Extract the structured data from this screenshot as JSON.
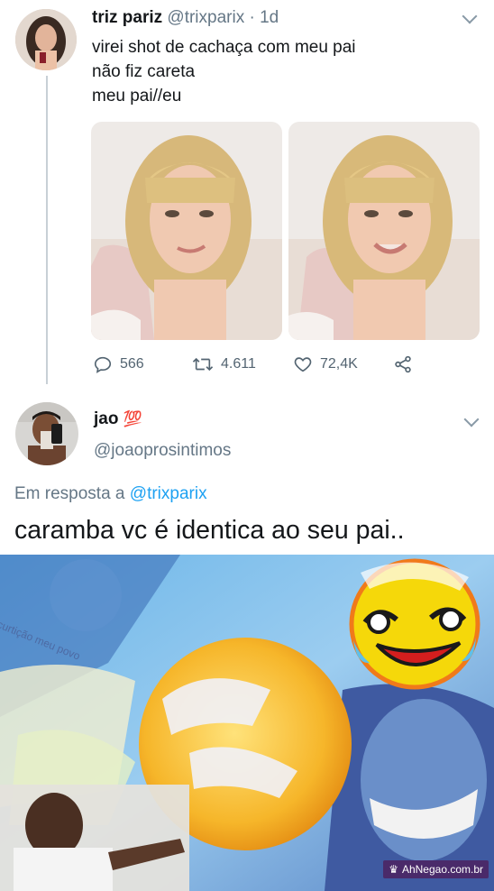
{
  "tweet1": {
    "display_name": "triz pariz",
    "handle_time": "@trixparix · 1d",
    "lines": [
      "virei shot de cachaça com meu pai",
      "não fiz careta",
      "meu pai//eu"
    ],
    "actions": {
      "replies": "566",
      "retweets": "4.611",
      "likes": "72,4K"
    }
  },
  "tweet2": {
    "display_name": "jao",
    "emoji": "💯",
    "handle": "@joaoprosintimos",
    "reply_prefix": "Em resposta a ",
    "reply_to": "@trixparix",
    "text": "caramba vc é identica ao seu pai.."
  },
  "meme": {
    "caption": "curtição meu povo",
    "watermark": "AhNegao.com.br"
  },
  "colors": {
    "link": "#1da1f2",
    "text": "#14171a",
    "muted": "#657786",
    "icon": "#536471"
  }
}
